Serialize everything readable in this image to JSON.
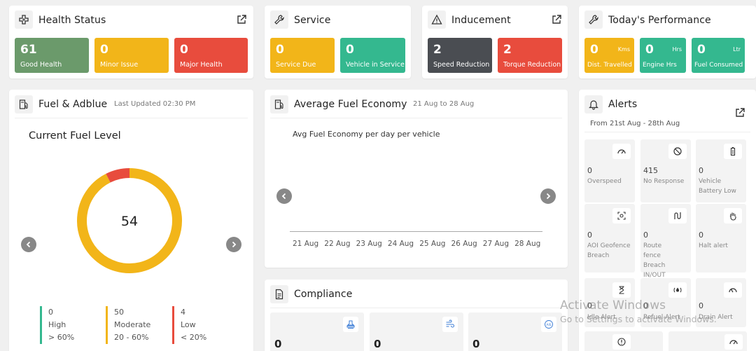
{
  "health": {
    "title": "Health Status",
    "tiles": [
      {
        "value": "61",
        "label": "Good Health",
        "color": "#6b9a6b"
      },
      {
        "value": "0",
        "label": "Minor Issue",
        "color": "#f2b519"
      },
      {
        "value": "0",
        "label": "Major Health",
        "color": "#e84c3d"
      }
    ]
  },
  "service": {
    "title": "Service",
    "tiles": [
      {
        "value": "0",
        "label": "Service Due",
        "color": "#f2b519"
      },
      {
        "value": "0",
        "label": "Vehicle in Service",
        "color": "#34b88f"
      }
    ]
  },
  "inducement": {
    "title": "Inducement",
    "tiles": [
      {
        "value": "2",
        "label": "Speed Reduction",
        "color": "#4a4d52"
      },
      {
        "value": "2",
        "label": "Torque Reduction",
        "color": "#e84c3d"
      }
    ]
  },
  "performance": {
    "title": "Today's Performance",
    "tiles": [
      {
        "value": "0",
        "unit": "Kms",
        "label": "Dist. Travelled",
        "color": "#f2b519"
      },
      {
        "value": "0",
        "unit": "Hrs",
        "label": "Engine Hrs",
        "color": "#34b88f"
      },
      {
        "value": "0",
        "unit": "Ltr",
        "label": "Fuel Consumed",
        "color": "#34b88f"
      }
    ]
  },
  "fuel": {
    "title": "Fuel & Adblue",
    "updated": "Last Updated 02:30 PM",
    "chart_title": "Current Fuel Level",
    "center_value": "54",
    "legend": [
      {
        "count": "0",
        "name": "High",
        "range": "> 60%",
        "color": "#34b88f"
      },
      {
        "count": "50",
        "name": "Moderate",
        "range": "20 - 60%",
        "color": "#f2b519"
      },
      {
        "count": "4",
        "name": "Low",
        "range": "< 20%",
        "color": "#e84c3d"
      }
    ]
  },
  "economy": {
    "title": "Average Fuel Economy",
    "range": "21 Aug to 28 Aug",
    "chart_title": "Avg Fuel Economy per day per vehicle"
  },
  "compliance": {
    "title": "Compliance",
    "tiles": [
      {
        "value": "0",
        "icon": "stamp-icon"
      },
      {
        "value": "0",
        "icon": "emission-icon"
      },
      {
        "value": "0",
        "icon": "ais-icon",
        "badge": "AIS"
      }
    ]
  },
  "alerts": {
    "title": "Alerts",
    "range": "From 21st Aug - 28th Aug",
    "items": [
      {
        "value": "0",
        "label": "Overspeed",
        "icon": "speedometer-icon"
      },
      {
        "value": "415",
        "label": "No Response",
        "icon": "no-entry-icon"
      },
      {
        "value": "0",
        "label": "Vehicle Battery Low",
        "icon": "battery-icon"
      },
      {
        "value": "0",
        "label": "AOI Geofence Breach",
        "icon": "geofence-icon"
      },
      {
        "value": "0",
        "label": "Route fence Breach IN/OUT",
        "icon": "route-icon"
      },
      {
        "value": "0",
        "label": "Halt alert",
        "icon": "hand-icon"
      },
      {
        "value": "0",
        "label": "Idle Alert",
        "icon": "hourglass-icon"
      },
      {
        "value": "0",
        "label": "Refuel Alert",
        "icon": "refuel-icon"
      },
      {
        "value": "0",
        "label": "Drain Alert",
        "icon": "drain-icon"
      }
    ]
  },
  "watermark": {
    "line1": "Activate Windows",
    "line2": "Go to Settings to activate Windows."
  },
  "chart_data": [
    {
      "type": "pie",
      "title": "Current Fuel Level",
      "categories": [
        "High",
        "Moderate",
        "Low"
      ],
      "values": [
        0,
        50,
        4
      ],
      "colors": [
        "#34b88f",
        "#f2b519",
        "#e84c3d"
      ],
      "total": 54
    },
    {
      "type": "line",
      "title": "Avg Fuel Economy per day per vehicle",
      "categories": [
        "21 Aug",
        "22 Aug",
        "23 Aug",
        "24 Aug",
        "25 Aug",
        "26 Aug",
        "27 Aug",
        "28 Aug"
      ],
      "series": []
    }
  ]
}
